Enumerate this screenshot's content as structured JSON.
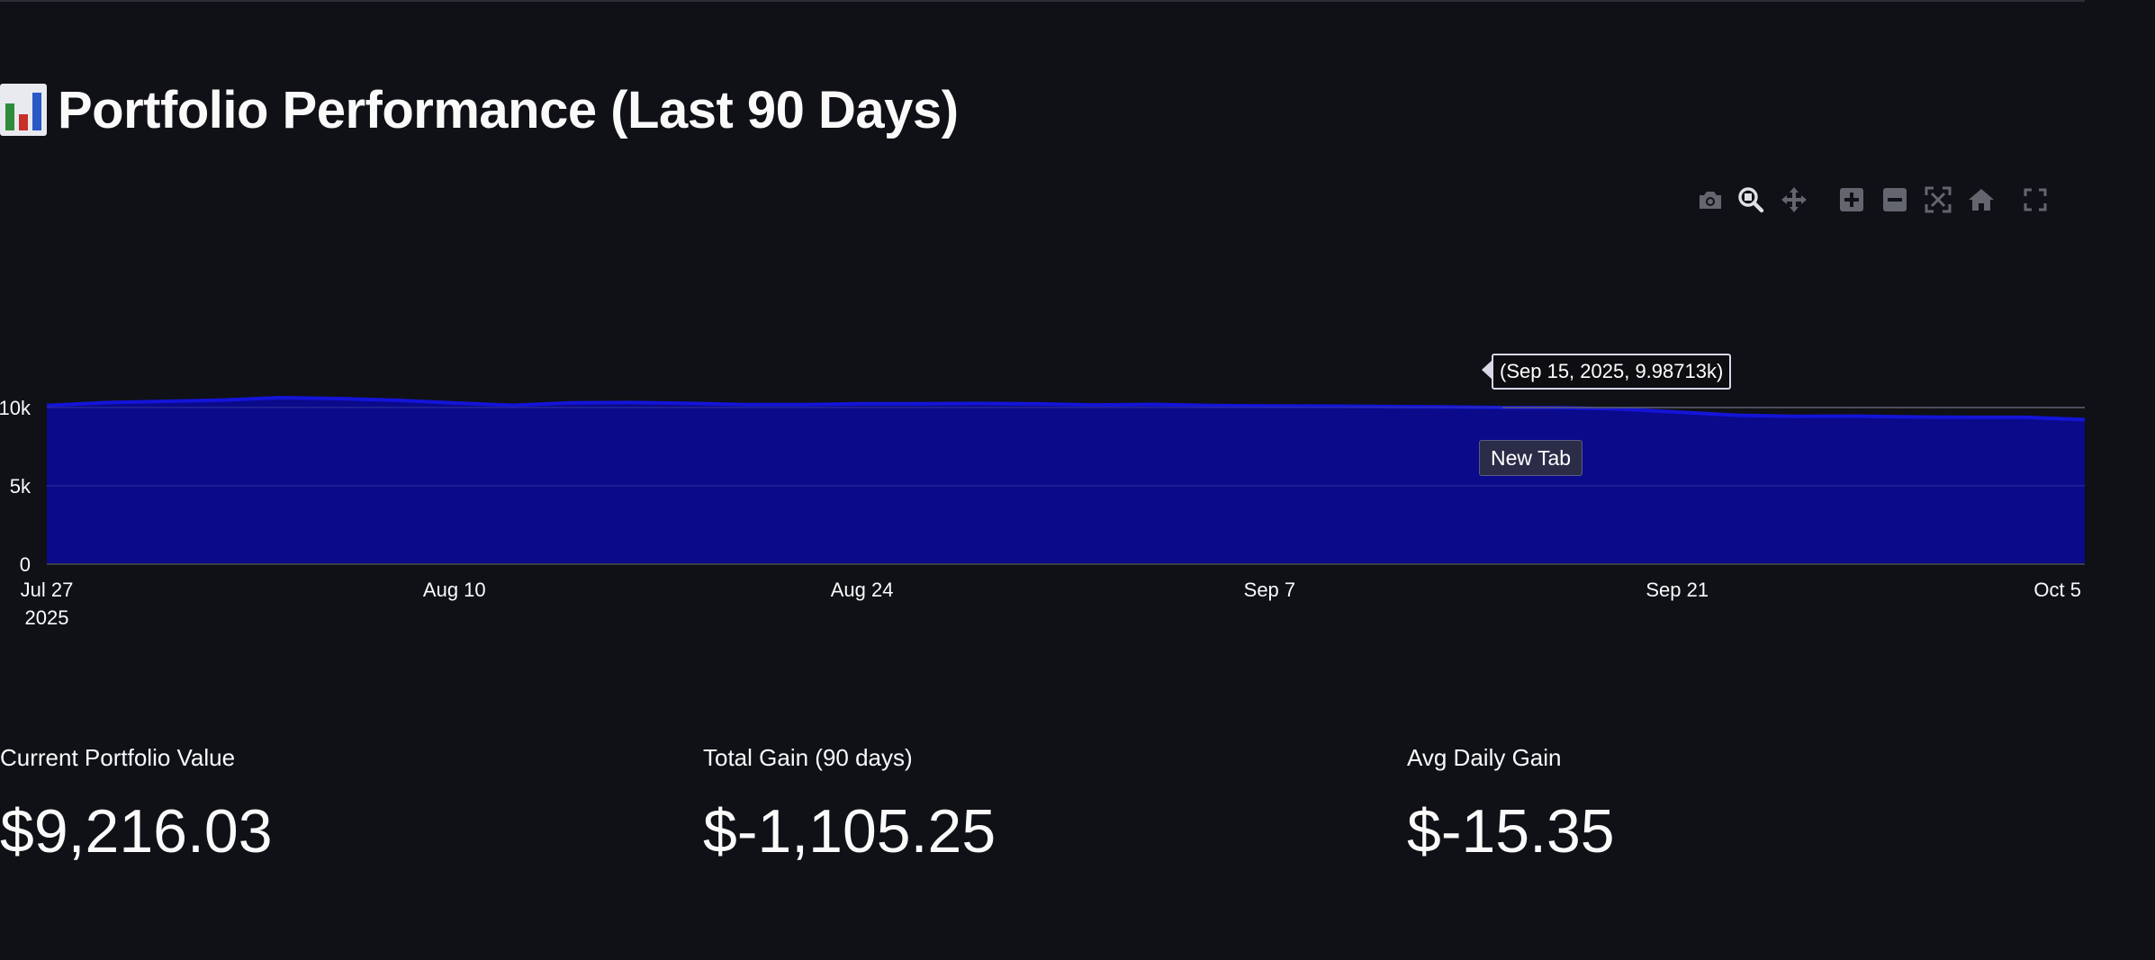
{
  "page": {
    "title": "Portfolio Performance (Last 90 Days)",
    "title_icon": "bar-chart-icon"
  },
  "modebar": {
    "buttons": [
      {
        "name": "camera-icon",
        "label": "Download plot as a png"
      },
      {
        "name": "zoom-icon",
        "label": "Zoom",
        "active": true
      },
      {
        "name": "pan-icon",
        "label": "Pan"
      },
      {
        "name": "zoom-in-icon",
        "label": "Zoom in"
      },
      {
        "name": "zoom-out-icon",
        "label": "Zoom out"
      },
      {
        "name": "autoscale-icon",
        "label": "Autoscale"
      },
      {
        "name": "home-icon",
        "label": "Reset axes"
      },
      {
        "name": "fullscreen-icon",
        "label": "Fullscreen"
      }
    ]
  },
  "tooltip": {
    "text": "(Sep 15, 2025, 9.98713k)"
  },
  "hover_label": {
    "text": "New Tab"
  },
  "metrics": [
    {
      "label": "Current Portfolio Value",
      "value": "$9,216.03"
    },
    {
      "label": "Total Gain (90 days)",
      "value": "$-1,105.25"
    },
    {
      "label": "Avg Daily Gain",
      "value": "$-15.35"
    }
  ],
  "colors": {
    "background": "#0f1116",
    "area_fill": "#0a0a8a",
    "line": "#1414d8",
    "text": "#fafafa"
  },
  "chart_data": {
    "type": "area",
    "x_type": "date",
    "x": [
      "2025-07-27",
      "2025-07-29",
      "2025-07-31",
      "2025-08-02",
      "2025-08-04",
      "2025-08-06",
      "2025-08-08",
      "2025-08-10",
      "2025-08-12",
      "2025-08-14",
      "2025-08-16",
      "2025-08-18",
      "2025-08-20",
      "2025-08-22",
      "2025-08-24",
      "2025-08-26",
      "2025-08-28",
      "2025-08-30",
      "2025-09-01",
      "2025-09-03",
      "2025-09-05",
      "2025-09-07",
      "2025-09-09",
      "2025-09-11",
      "2025-09-13",
      "2025-09-15",
      "2025-09-17",
      "2025-09-19",
      "2025-09-21",
      "2025-09-23",
      "2025-09-25",
      "2025-09-27",
      "2025-09-29",
      "2025-10-01",
      "2025-10-03",
      "2025-10-05"
    ],
    "y": [
      10120,
      10300,
      10380,
      10460,
      10620,
      10560,
      10450,
      10280,
      10130,
      10290,
      10310,
      10260,
      10170,
      10170,
      10230,
      10230,
      10250,
      10220,
      10150,
      10190,
      10110,
      10090,
      10080,
      10050,
      10030,
      9987,
      9980,
      9900,
      9700,
      9500,
      9430,
      9440,
      9390,
      9360,
      9360,
      9216
    ],
    "x_ticks": [
      {
        "value": "2025-07-27",
        "label": "Jul 27",
        "sublabel": "2025"
      },
      {
        "value": "2025-08-10",
        "label": "Aug 10"
      },
      {
        "value": "2025-08-24",
        "label": "Aug 24"
      },
      {
        "value": "2025-09-07",
        "label": "Sep 7"
      },
      {
        "value": "2025-09-21",
        "label": "Sep 21"
      },
      {
        "value": "2025-10-05",
        "label": "Oct 5"
      }
    ],
    "y_ticks": [
      {
        "value": 0,
        "label": "0"
      },
      {
        "value": 5000,
        "label": "5k"
      },
      {
        "value": 10000,
        "label": "10k"
      }
    ],
    "xlim": [
      "2025-07-27",
      "2025-10-05"
    ],
    "ylim": [
      0,
      14750
    ],
    "grid": true,
    "hover_point": {
      "x": "2025-09-15",
      "y": 9987.13
    }
  }
}
